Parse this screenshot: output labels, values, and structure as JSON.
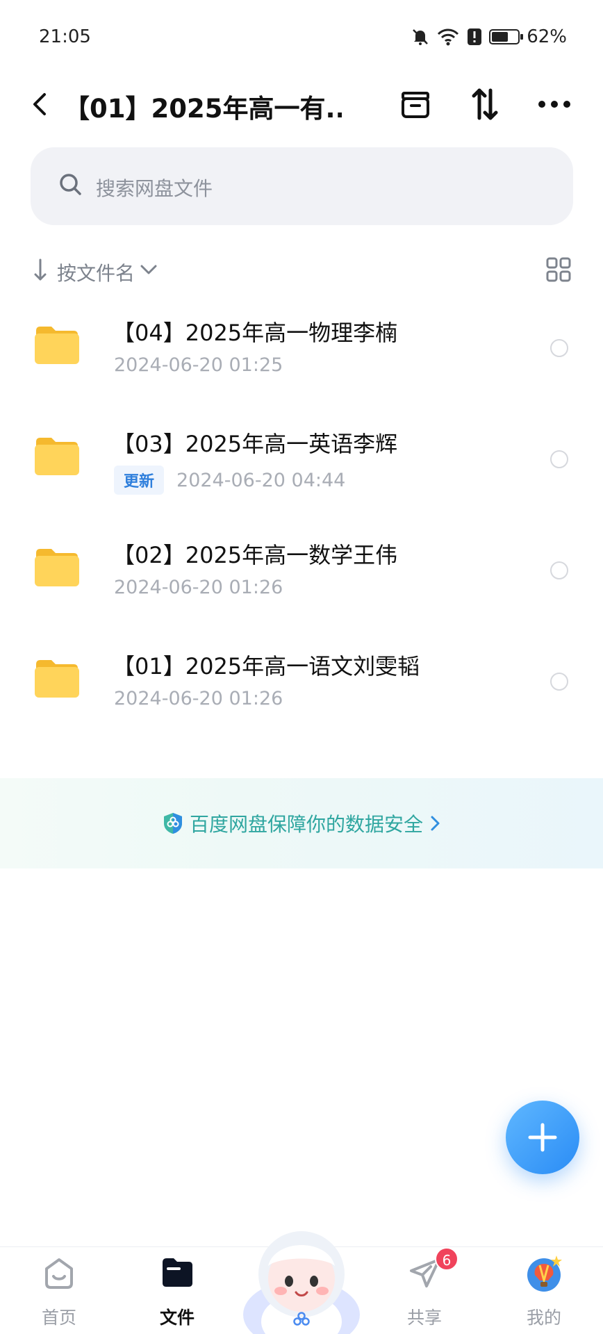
{
  "status_bar": {
    "time": "21:05",
    "battery": "62%",
    "battery_level": 0.62,
    "icons": [
      "bell-off-icon",
      "wifi-icon",
      "alert-icon",
      "battery-icon"
    ]
  },
  "header": {
    "title": "【01】2025年高一有...",
    "icons": [
      "back-icon",
      "archive-icon",
      "sort-swap-icon",
      "more-icon"
    ]
  },
  "search": {
    "placeholder": "搜索网盘文件"
  },
  "sort": {
    "label": "按文件名"
  },
  "files": [
    {
      "name": "【04】2025年高一物理李楠",
      "date": "2024-06-20  01:25",
      "badge": ""
    },
    {
      "name": "【03】2025年高一英语李辉",
      "date": "2024-06-20  04:44",
      "badge": "更新"
    },
    {
      "name": "【02】2025年高一数学王伟",
      "date": "2024-06-20  01:26",
      "badge": ""
    },
    {
      "name": "【01】2025年高一语文刘雯韬",
      "date": "2024-06-20  01:26",
      "badge": ""
    }
  ],
  "security_banner": {
    "text": "百度网盘保障你的数据安全"
  },
  "bottom_nav": {
    "home": "首页",
    "files": "文件",
    "share": "共享",
    "share_badge": "6",
    "me": "我的"
  },
  "colors": {
    "accent": "#2a8cf5",
    "folder": "#ffd45a",
    "security": "#2fa6a0",
    "badge": "#f0435b"
  }
}
